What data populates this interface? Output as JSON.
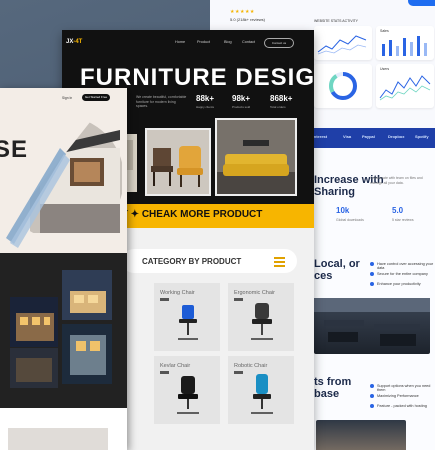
{
  "dashboard": {
    "rating_label": "5.0 (218k+ reviews)",
    "stars": "★★★★★",
    "website_stats": "WEBSITE STATS ACTIVITY",
    "card_a": "Users",
    "card_b": "Sales",
    "partners": [
      "Pinterest",
      "Visa",
      "Paypal",
      "Dropbox",
      "Spotify"
    ],
    "headline_1": "Increase with",
    "headline_2": "Sharing",
    "stats": [
      {
        "value": "10k",
        "label": "Global downloads"
      },
      {
        "value": "5.0",
        "label": "5 star reviews"
      }
    ],
    "section_2_title_1": "Local, or",
    "section_2_title_2": "ces",
    "bullets_1": [
      "Have control over accessing your data",
      "Secure for the entire company",
      "Enhance your productivity"
    ],
    "section_3_title_1": "ts from",
    "section_3_title_2": "base",
    "bullets_2": [
      "Support options when you need them",
      "Maximizing Performance",
      "Feature - packed with hosting"
    ]
  },
  "furniture": {
    "logo_prefix": "JX",
    "logo_suffix": "-4T",
    "nav": [
      "Home",
      "Product",
      "Blog",
      "Contact"
    ],
    "contact_button": "Contact us",
    "hero_title": "FURNITURE  DESIGN",
    "hero_desc": "We create beautiful, comfortable furniture for modern living spaces.",
    "stats": [
      {
        "value": "88k+",
        "label": "Happy clients"
      },
      {
        "value": "98k+",
        "label": "Products sold"
      },
      {
        "value": "868k+",
        "label": "Total orders"
      }
    ],
    "banner": "ORE PRODUCT  ✦  CHEAK MORE PRODUCT",
    "category_title": "CATEGORY BY PRODUCT",
    "products": [
      "Working Chair",
      "Ergonomic Chair",
      "Kevlar Chair",
      "Robotic Chair"
    ]
  },
  "architecture": {
    "big_text": "SE",
    "nav": [
      "Sign In"
    ],
    "button": "Get Started Free"
  },
  "colors": {
    "accent_yellow": "#f7b500",
    "dash_blue": "#2a64e4",
    "dark": "#111111"
  }
}
